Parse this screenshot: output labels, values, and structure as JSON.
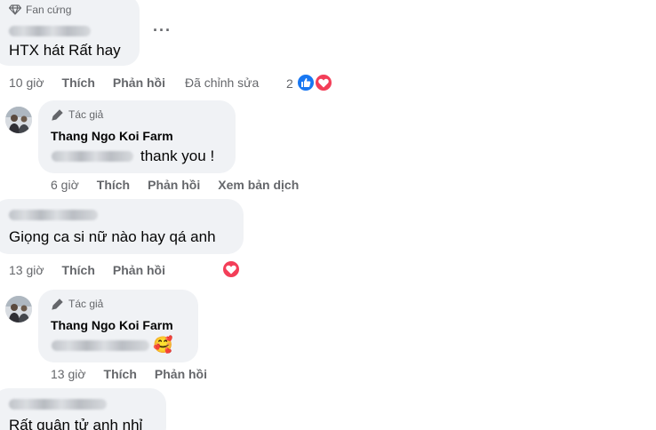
{
  "colors": {
    "like_blue": "#1877f2",
    "love_red": "#f33e58",
    "bubble_bg": "#f0f2f5",
    "meta_gray": "#65676b"
  },
  "comments": [
    {
      "badge_label": "Fan cứng",
      "badge_icon": "diamond-icon",
      "text": "HTX hát Rất hay",
      "time": "10 giờ",
      "like": "Thích",
      "reply": "Phản hồi",
      "edited": "Đã chỉnh sửa",
      "reaction_count": "2",
      "reactions": [
        "like-icon",
        "love-icon"
      ]
    },
    {
      "badge_label": "Tác giả",
      "badge_icon": "pencil-icon",
      "author": "Thang Ngo Koi Farm",
      "text_tail": "thank you !",
      "time": "6 giờ",
      "like": "Thích",
      "reply": "Phản hồi",
      "translate": "Xem bản dịch"
    },
    {
      "text": "Giọng ca si nữ nào hay qá anh",
      "time": "13 giờ",
      "like": "Thích",
      "reply": "Phản hồi",
      "reactions": [
        "love-icon"
      ]
    },
    {
      "badge_label": "Tác giả",
      "badge_icon": "pencil-icon",
      "author": "Thang Ngo Koi Farm",
      "emoji": "🥰",
      "time": "13 giờ",
      "like": "Thích",
      "reply": "Phản hồi"
    },
    {
      "text": "Rất quân tử anh nhỉ"
    }
  ]
}
